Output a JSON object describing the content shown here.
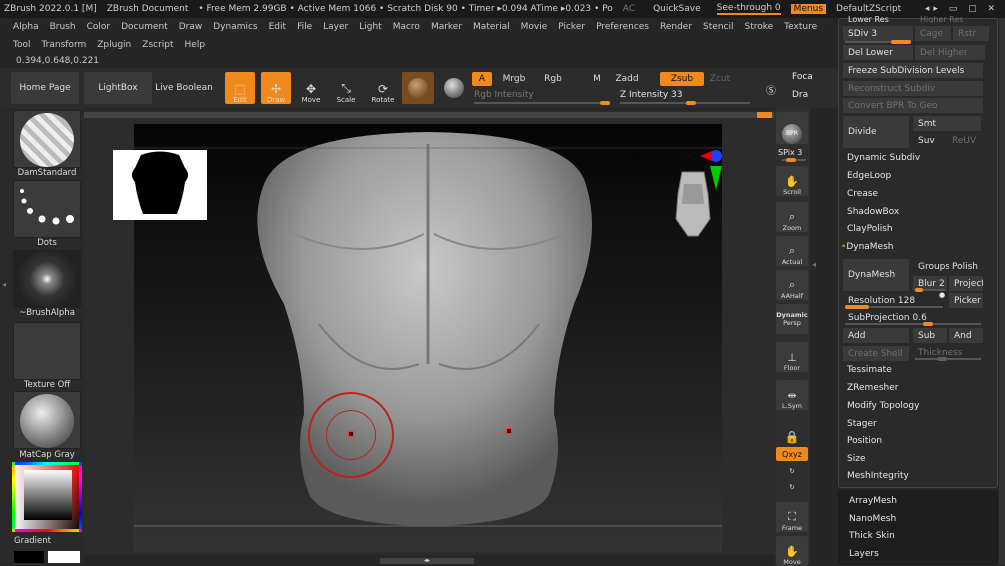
{
  "title": {
    "app": "ZBrush 2022.0.1 [M]",
    "doc": "ZBrush Document",
    "mem": "• Free Mem 2.99GB • Active Mem 1066 • Scratch Disk 90 • Timer ▸0.094 ATime ▸0.023 • Po",
    "ac": "AC",
    "quicksave": "QuickSave",
    "seethrough": "See-through  0",
    "menus": "Menus",
    "script": "DefaultZScript"
  },
  "menu": [
    "Alpha",
    "Brush",
    "Color",
    "Document",
    "Draw",
    "Dynamics",
    "Edit",
    "File",
    "Layer",
    "Light",
    "Macro",
    "Marker",
    "Material",
    "Movie",
    "Picker",
    "Preferences",
    "Render",
    "Stencil",
    "Stroke",
    "Texture"
  ],
  "menu2": [
    "Tool",
    "Transform",
    "Zplugin",
    "Zscript",
    "Help"
  ],
  "coords": "0.394,0.648,0.221",
  "toolbar": {
    "home": "Home Page",
    "lightbox": "LightBox",
    "liveboolean": "Live Boolean",
    "edit": "Edit",
    "draw": "Draw",
    "move": "Move",
    "scale": "Scale",
    "rotate": "Rotate",
    "a": "A",
    "mrgb": "Mrgb",
    "rgb": "Rgb",
    "m": "M",
    "zadd": "Zadd",
    "zsub": "Zsub",
    "zcut": "Zcut",
    "rgbintensity": "Rgb Intensity",
    "zintensity": "Z Intensity 33",
    "focal": "Foca",
    "draw2": "Dra"
  },
  "left": {
    "brush": "DamStandard",
    "stroke": "Dots",
    "alpha": "~BrushAlpha",
    "texture": "Texture Off",
    "material": "MatCap Gray",
    "gradient": "Gradient"
  },
  "right": {
    "bpr": "BPR",
    "spix": "SPix 3",
    "scroll": "Scroll",
    "zoom": "Zoom",
    "actual": "Actual",
    "aahalf": "AAHalf",
    "dynamic": "Dynamic",
    "persp": "Persp",
    "floor": "Floor",
    "lsym": "L.Sym",
    "xyz": "Qxyz",
    "frame": "Frame",
    "move": "Move"
  },
  "panel": {
    "lowerres": "Lower Res",
    "higherres": "Higher Res",
    "sdiv": "SDiv 3",
    "cage": "Cage",
    "rstr": "Rstr",
    "dellower": "Del Lower",
    "delhigher": "Del Higher",
    "freeze": "Freeze SubDivision Levels",
    "reconstruct": "Reconstruct Subdiv",
    "convertbpr": "Convert BPR To Geo",
    "divide": "Divide",
    "smt": "Smt",
    "suv": "Suv",
    "reuv": "ReUV",
    "dynsubdiv": "Dynamic Subdiv",
    "edgeloop": "EdgeLoop",
    "crease": "Crease",
    "shadowbox": "ShadowBox",
    "claypolish": "ClayPolish",
    "dynamesh": "DynaMesh",
    "dynamesh_btn": "DynaMesh",
    "groups": "Groups",
    "polish": "Polish",
    "blur": "Blur 2",
    "project": "Project",
    "resolution": "Resolution 128",
    "picker": "Picker",
    "subprojection": "SubProjection 0.6",
    "add": "Add",
    "sub": "Sub",
    "and": "And",
    "createshell": "Create Shell",
    "thickness": "Thickness",
    "tessimate": "Tessimate",
    "zremesher": "ZRemesher",
    "modifytopo": "Modify Topology",
    "stager": "Stager",
    "position": "Position",
    "size": "Size",
    "meshintegrity": "MeshIntegrity",
    "arraymesh": "ArrayMesh",
    "nanomesh": "NanoMesh",
    "thickskin": "Thick Skin",
    "layers": "Layers"
  },
  "colors": {
    "accent": "#f08a1c",
    "bg": "#262626"
  }
}
